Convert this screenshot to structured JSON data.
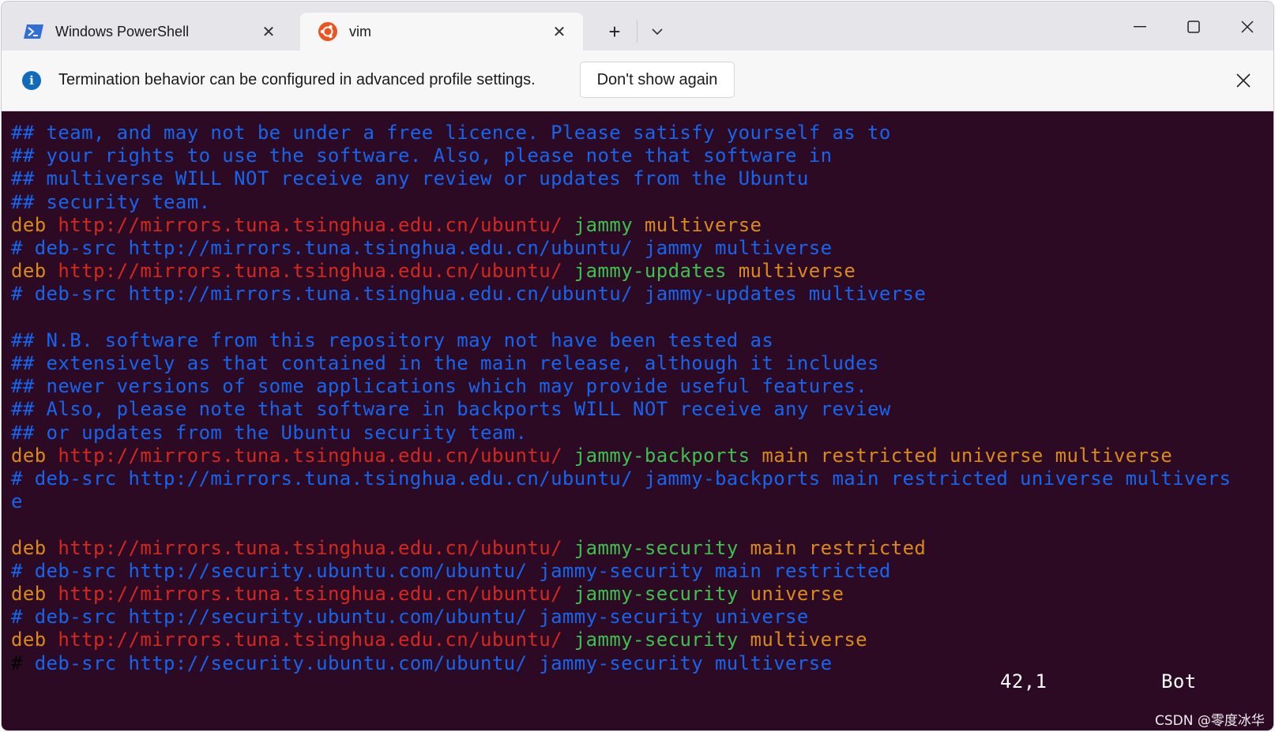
{
  "tabs": [
    {
      "title": "Windows PowerShell",
      "icon": "powershell-icon"
    },
    {
      "title": "vim",
      "icon": "ubuntu-icon"
    }
  ],
  "window_controls": {
    "new_tab": "+",
    "minimize": "minimize-icon",
    "maximize": "maximize-icon",
    "close": "close-icon"
  },
  "infobar": {
    "message": "Termination behavior can be configured in advanced profile settings.",
    "dont_show_label": "Don't show again"
  },
  "terminal": {
    "lines": [
      {
        "segments": [
          {
            "t": "## team, and may not be under a free licence. Please satisfy yourself as to",
            "c": "comment"
          }
        ]
      },
      {
        "segments": [
          {
            "t": "## your rights to use the software. Also, please note that software in",
            "c": "comment"
          }
        ]
      },
      {
        "segments": [
          {
            "t": "## multiverse WILL NOT receive any review or updates from the Ubuntu",
            "c": "comment"
          }
        ]
      },
      {
        "segments": [
          {
            "t": "## security team.",
            "c": "comment"
          }
        ]
      },
      {
        "segments": [
          {
            "t": "deb ",
            "c": "deb"
          },
          {
            "t": "http://mirrors.tuna.tsinghua.edu.cn/ubuntu/",
            "c": "url"
          },
          {
            "t": " ",
            "c": "deb"
          },
          {
            "t": "jammy",
            "c": "suite"
          },
          {
            "t": " multiverse",
            "c": "comp"
          }
        ]
      },
      {
        "segments": [
          {
            "t": "# deb-src http://mirrors.tuna.tsinghua.edu.cn/ubuntu/ jammy multiverse",
            "c": "comment"
          }
        ]
      },
      {
        "segments": [
          {
            "t": "deb ",
            "c": "deb"
          },
          {
            "t": "http://mirrors.tuna.tsinghua.edu.cn/ubuntu/",
            "c": "url"
          },
          {
            "t": " ",
            "c": "deb"
          },
          {
            "t": "jammy-updates",
            "c": "suite"
          },
          {
            "t": " multiverse",
            "c": "comp"
          }
        ]
      },
      {
        "segments": [
          {
            "t": "# deb-src http://mirrors.tuna.tsinghua.edu.cn/ubuntu/ jammy-updates multiverse",
            "c": "comment"
          }
        ]
      },
      {
        "segments": [
          {
            "t": "",
            "c": "comment"
          }
        ]
      },
      {
        "segments": [
          {
            "t": "## N.B. software from this repository may not have been tested as",
            "c": "comment"
          }
        ]
      },
      {
        "segments": [
          {
            "t": "## extensively as that contained in the main release, although it includes",
            "c": "comment"
          }
        ]
      },
      {
        "segments": [
          {
            "t": "## newer versions of some applications which may provide useful features.",
            "c": "comment"
          }
        ]
      },
      {
        "segments": [
          {
            "t": "## Also, please note that software in backports WILL NOT receive any review",
            "c": "comment"
          }
        ]
      },
      {
        "segments": [
          {
            "t": "## or updates from the Ubuntu security team.",
            "c": "comment"
          }
        ]
      },
      {
        "segments": [
          {
            "t": "deb ",
            "c": "deb"
          },
          {
            "t": "http://mirrors.tuna.tsinghua.edu.cn/ubuntu/",
            "c": "url"
          },
          {
            "t": " ",
            "c": "deb"
          },
          {
            "t": "jammy-backports",
            "c": "suite"
          },
          {
            "t": " main restricted universe multiverse",
            "c": "comp"
          }
        ]
      },
      {
        "segments": [
          {
            "t": "# deb-src http://mirrors.tuna.tsinghua.edu.cn/ubuntu/ jammy-backports main restricted universe multivers",
            "c": "comment"
          }
        ]
      },
      {
        "segments": [
          {
            "t": "e",
            "c": "comment"
          }
        ]
      },
      {
        "segments": [
          {
            "t": "",
            "c": "comment"
          }
        ]
      },
      {
        "segments": [
          {
            "t": "deb ",
            "c": "deb"
          },
          {
            "t": "http://mirrors.tuna.tsinghua.edu.cn/ubuntu/",
            "c": "url"
          },
          {
            "t": " ",
            "c": "deb"
          },
          {
            "t": "jammy-security",
            "c": "suite"
          },
          {
            "t": " main restricted",
            "c": "comp"
          }
        ]
      },
      {
        "segments": [
          {
            "t": "# deb-src http://security.ubuntu.com/ubuntu/ jammy-security main restricted",
            "c": "comment"
          }
        ]
      },
      {
        "segments": [
          {
            "t": "deb ",
            "c": "deb"
          },
          {
            "t": "http://mirrors.tuna.tsinghua.edu.cn/ubuntu/",
            "c": "url"
          },
          {
            "t": " ",
            "c": "deb"
          },
          {
            "t": "jammy-security",
            "c": "suite"
          },
          {
            "t": " universe",
            "c": "comp"
          }
        ]
      },
      {
        "segments": [
          {
            "t": "# deb-src http://security.ubuntu.com/ubuntu/ jammy-security universe",
            "c": "comment"
          }
        ]
      },
      {
        "segments": [
          {
            "t": "deb ",
            "c": "deb"
          },
          {
            "t": "http://mirrors.tuna.tsinghua.edu.cn/ubuntu/",
            "c": "url"
          },
          {
            "t": " ",
            "c": "deb"
          },
          {
            "t": "jammy-security",
            "c": "suite"
          },
          {
            "t": " multiverse",
            "c": "comp"
          }
        ]
      },
      {
        "segments": [
          {
            "t": "#",
            "c": "cursor"
          },
          {
            "t": " deb-src http://security.ubuntu.com/ubuntu/ jammy-security multiverse",
            "c": "comment"
          }
        ]
      }
    ],
    "status_position": "42,1",
    "status_scroll": "Bot"
  },
  "watermark": "CSDN @零度冰华",
  "colors": {
    "terminal_bg": "#2d0a24",
    "comment": "#1565f0",
    "keyword": "#d98a19",
    "url": "#d4281e",
    "suite": "#3ec04f",
    "info_accent": "#0f6cbd"
  }
}
